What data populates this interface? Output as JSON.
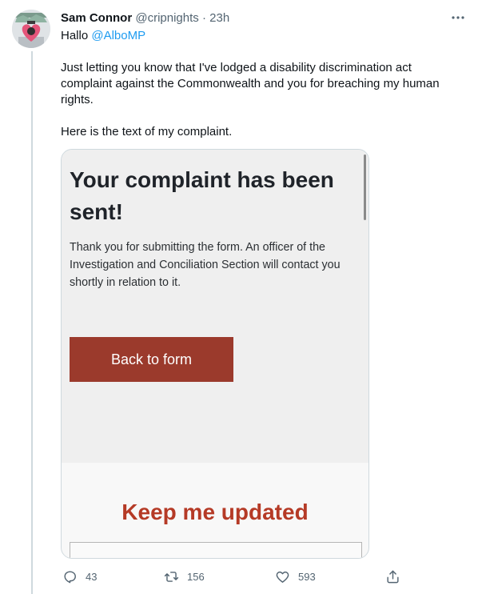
{
  "tweet": {
    "display_name": "Sam Connor",
    "handle": "@cripnights",
    "separator": "·",
    "time": "23h",
    "greeting": "Hallo",
    "mention": "@AlboMP",
    "paragraph1": "Just letting you know that I've lodged a disability discrimination act complaint against the Commonwealth and you for breaching my human rights.",
    "paragraph2": "Here is the text of my complaint."
  },
  "embedded_screenshot": {
    "heading": "Your complaint has been sent!",
    "body": "Thank you for submitting the form. An officer of the Investigation and Conciliation Section will contact you shortly in relation to it.",
    "button_label": "Back to form",
    "section_heading": "Keep me updated"
  },
  "actions": {
    "replies": "43",
    "retweets": "156",
    "likes": "593"
  },
  "colors": {
    "accent": "#1d9bf0",
    "button": "#9b3a2c",
    "heading_red": "#b53a26",
    "muted": "#536471"
  }
}
